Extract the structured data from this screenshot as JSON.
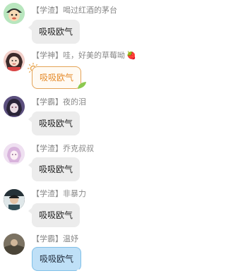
{
  "messages": [
    {
      "name": "【学渣】喝过红酒的茅台",
      "text": "吸吸欧气"
    },
    {
      "name": "【学神】哇，好美的草莓呦",
      "text": "吸吸欧气",
      "name_emoji": "🍓"
    },
    {
      "name": "【学霸】夜的泪",
      "text": "吸吸欧气"
    },
    {
      "name": "【学渣】乔克叔叔",
      "text": "吸吸欧气"
    },
    {
      "name": "【学渣】非暴力",
      "text": "吸吸欧气"
    },
    {
      "name": "【学霸】温妤",
      "text": "吸吸欧气"
    }
  ],
  "colors": {
    "name_text": "#888888",
    "bubble_bg": "#ececec",
    "orange_accent": "#e58a29",
    "blue_bubble": "#bfe0f7"
  }
}
